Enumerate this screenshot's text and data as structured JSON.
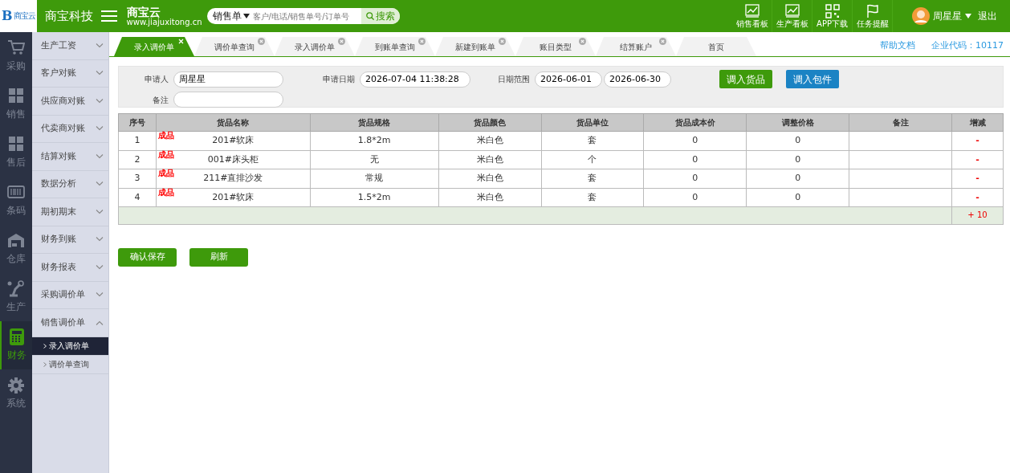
{
  "header": {
    "logo": {
      "mark": "B",
      "text": "商宝云"
    },
    "company": "商宝科技",
    "brand": {
      "name": "商宝云",
      "url": "www.jiajuxitong.cn"
    },
    "search": {
      "scope": "销售单",
      "placeholder": "客户/电话/销售单号/订单号",
      "button": "搜索"
    },
    "shortcuts": [
      {
        "label": "销售看板",
        "kind": "chart"
      },
      {
        "label": "生产看板",
        "kind": "chart"
      },
      {
        "label": "APP下载",
        "kind": "qr"
      },
      {
        "label": "任务提醒",
        "kind": "flag"
      }
    ],
    "user": {
      "name": "周星星"
    },
    "logout": "退出"
  },
  "rail": [
    {
      "label": "采购",
      "kind": "cart",
      "selected": false
    },
    {
      "label": "销售",
      "kind": "boxes",
      "selected": false
    },
    {
      "label": "售后",
      "kind": "boxes",
      "selected": false
    },
    {
      "label": "条码",
      "kind": "barcode",
      "selected": false
    },
    {
      "label": "仓库",
      "kind": "warehouse",
      "selected": false
    },
    {
      "label": "生产",
      "kind": "robot",
      "selected": false
    },
    {
      "label": "财务",
      "kind": "calculator",
      "selected": true
    },
    {
      "label": "系统",
      "kind": "gear",
      "selected": false
    }
  ],
  "menu": [
    {
      "label": "生产工资",
      "expanded": false
    },
    {
      "label": "客户对账",
      "expanded": false
    },
    {
      "label": "供应商对账",
      "expanded": false
    },
    {
      "label": "代卖商对账",
      "expanded": false
    },
    {
      "label": "结算对账",
      "expanded": false
    },
    {
      "label": "数据分析",
      "expanded": false
    },
    {
      "label": "期初期末",
      "expanded": false
    },
    {
      "label": "财务到账",
      "expanded": false
    },
    {
      "label": "财务报表",
      "expanded": false
    },
    {
      "label": "采购调价单",
      "expanded": false
    },
    {
      "label": "销售调价单",
      "expanded": true,
      "children": [
        {
          "label": "录入调价单",
          "selected": true
        },
        {
          "label": "调价单查询",
          "selected": false
        }
      ]
    }
  ],
  "tabs": [
    {
      "label": "录入调价单",
      "selected": true,
      "closable": true
    },
    {
      "label": "调价单查询",
      "selected": false,
      "closable": true
    },
    {
      "label": "录入调价单",
      "selected": false,
      "closable": true
    },
    {
      "label": "到账单查询",
      "selected": false,
      "closable": true
    },
    {
      "label": "新建到账单",
      "selected": false,
      "closable": true
    },
    {
      "label": "账目类型",
      "selected": false,
      "closable": true
    },
    {
      "label": "结算账户",
      "selected": false,
      "closable": true
    },
    {
      "label": "首页",
      "selected": false,
      "closable": false
    }
  ],
  "help_link": "帮助文档",
  "company_code": "企业代码：10117",
  "form": {
    "applicant": {
      "label": "申请人",
      "value": "周星星"
    },
    "date": {
      "label": "申请日期",
      "value": "2026-07-04 11:38:28"
    },
    "range": {
      "label": "日期范围",
      "from": "2026-06-01",
      "to": "2026-06-30"
    },
    "remark": {
      "label": "备注"
    },
    "buttons": [
      {
        "label": "调入货品",
        "kind": "green"
      },
      {
        "label": "调入包件",
        "kind": "blue"
      }
    ]
  },
  "table": {
    "columns": [
      "序号",
      "货品名称",
      "货品规格",
      "货品颜色",
      "货品单位",
      "货品成本价",
      "调整价格",
      "备注",
      "增减"
    ],
    "rows": [
      {
        "no": "1",
        "tag": "成品",
        "name": "201#软床",
        "spec": "1.8*2m",
        "finish": "米白色",
        "unit": "套",
        "cost": "0",
        "price": "0",
        "remove": "-"
      },
      {
        "no": "2",
        "tag": "成品",
        "name": "001#床头柜",
        "spec": "无",
        "finish": "米白色",
        "unit": "个",
        "cost": "0",
        "price": "0",
        "remove": "-"
      },
      {
        "no": "3",
        "tag": "成品",
        "name": "211#直排沙发",
        "spec": "常规",
        "finish": "米白色",
        "unit": "套",
        "cost": "0",
        "price": "0",
        "remove": "-"
      },
      {
        "no": "4",
        "tag": "成品",
        "name": "201#软床",
        "spec": "1.5*2m",
        "finish": "米白色",
        "unit": "套",
        "cost": "0",
        "price": "0",
        "remove": "-"
      }
    ],
    "add": "+ 10"
  },
  "actions": [
    "确认保存",
    "刷新"
  ]
}
